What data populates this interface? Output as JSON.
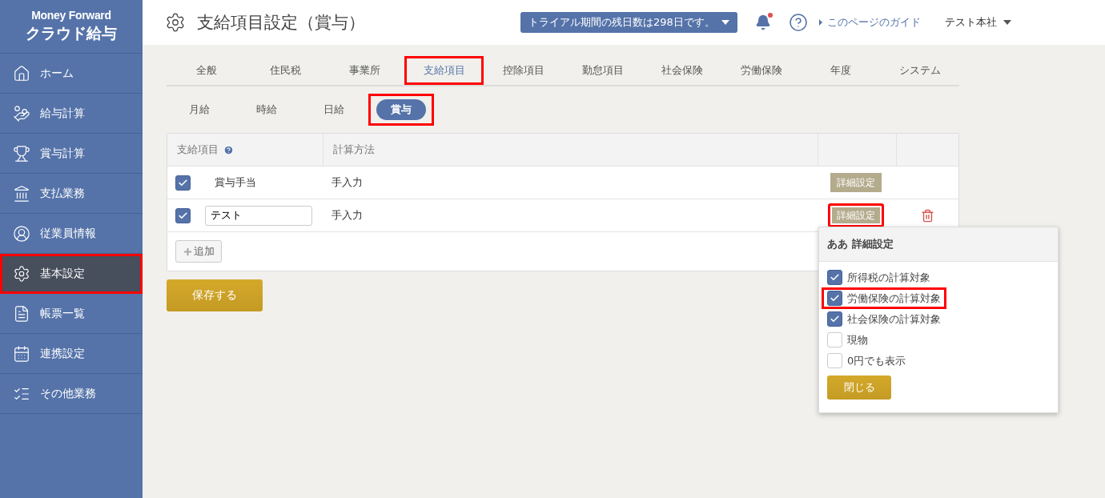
{
  "logo": {
    "brand": "Money Forward",
    "product": "クラウド給与"
  },
  "sidebar": {
    "items": [
      {
        "label": "ホーム",
        "selected": false,
        "highlighted": false
      },
      {
        "label": "給与計算",
        "selected": false,
        "highlighted": false
      },
      {
        "label": "賞与計算",
        "selected": false,
        "highlighted": false
      },
      {
        "label": "支払業務",
        "selected": false,
        "highlighted": false
      },
      {
        "label": "従業員情報",
        "selected": false,
        "highlighted": false
      },
      {
        "label": "基本設定",
        "selected": true,
        "highlighted": true
      },
      {
        "label": "帳票一覧",
        "selected": false,
        "highlighted": false
      },
      {
        "label": "連携設定",
        "selected": false,
        "highlighted": false
      },
      {
        "label": "その他業務",
        "selected": false,
        "highlighted": false
      }
    ]
  },
  "header": {
    "title": "支給項目設定（賞与）",
    "trial": "トライアル期間の残日数は298日です。",
    "guide": "このページのガイド",
    "company": "テスト本社"
  },
  "tabs": [
    {
      "label": "全般",
      "selected": false,
      "highlighted": false
    },
    {
      "label": "住民税",
      "selected": false,
      "highlighted": false
    },
    {
      "label": "事業所",
      "selected": false,
      "highlighted": false
    },
    {
      "label": "支給項目",
      "selected": true,
      "highlighted": true
    },
    {
      "label": "控除項目",
      "selected": false,
      "highlighted": false
    },
    {
      "label": "勤怠項目",
      "selected": false,
      "highlighted": false
    },
    {
      "label": "社会保険",
      "selected": false,
      "highlighted": false
    },
    {
      "label": "労働保険",
      "selected": false,
      "highlighted": false
    },
    {
      "label": "年度",
      "selected": false,
      "highlighted": false
    },
    {
      "label": "システム",
      "selected": false,
      "highlighted": false
    }
  ],
  "subtabs": [
    {
      "label": "月給",
      "selected": false,
      "highlighted": false
    },
    {
      "label": "時給",
      "selected": false,
      "highlighted": false
    },
    {
      "label": "日給",
      "selected": false,
      "highlighted": false
    },
    {
      "label": "賞与",
      "selected": true,
      "highlighted": true
    }
  ],
  "table": {
    "columns": [
      "支給項目",
      "計算方法"
    ],
    "rows": [
      {
        "checked": true,
        "kind": "text",
        "name": "賞与手当",
        "method": "手入力",
        "detail": "詳細設定",
        "detail_highlighted": false,
        "deletable": false
      },
      {
        "checked": true,
        "kind": "input",
        "name": "テスト",
        "method": "手入力",
        "detail": "詳細設定",
        "detail_highlighted": true,
        "deletable": true
      }
    ],
    "add_button": "追加"
  },
  "save_button": "保存する",
  "popup": {
    "title": "ああ 詳細設定",
    "options": [
      {
        "label": "所得税の計算対象",
        "checked": true,
        "highlighted": false
      },
      {
        "label": "労働保険の計算対象",
        "checked": true,
        "highlighted": true
      },
      {
        "label": "社会保険の計算対象",
        "checked": true,
        "highlighted": false
      },
      {
        "label": "現物",
        "checked": false,
        "highlighted": false
      },
      {
        "label": "0円でも表示",
        "checked": false,
        "highlighted": false
      }
    ],
    "close_button": "閉じる"
  }
}
